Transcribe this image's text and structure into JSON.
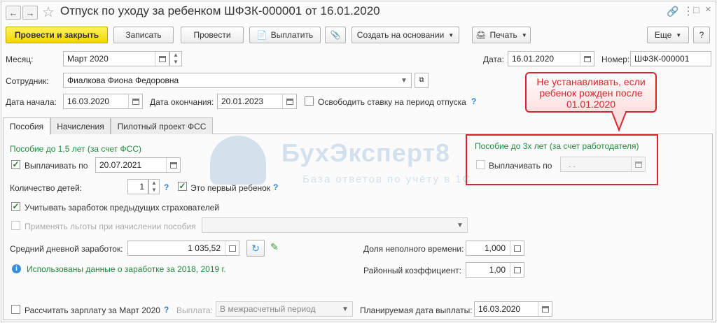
{
  "header": {
    "title": "Отпуск по уходу за ребенком ШФЗК-000001 от 16.01.2020",
    "back_icon": "arrow-left-icon",
    "forward_icon": "arrow-right-icon",
    "star_icon": "star-icon"
  },
  "toolbar": {
    "post_close": "Провести и закрыть",
    "save": "Записать",
    "post": "Провести",
    "pay": "Выплатить",
    "create_based": "Создать на основании",
    "print": "Печать",
    "more": "Еще",
    "help": "?"
  },
  "fields": {
    "month_label": "Месяц:",
    "month_value": "Март 2020",
    "date_label": "Дата:",
    "date_value": "16.01.2020",
    "number_label": "Номер:",
    "number_value": "ШФЗК-000001",
    "employee_label": "Сотрудник:",
    "employee_value": "Фиалкова Фиона Федоровна",
    "start_label": "Дата начала:",
    "start_value": "16.03.2020",
    "end_label": "Дата окончания:",
    "end_value": "20.01.2023",
    "free_rate_label": "Освободить ставку на период отпуска",
    "q": "?"
  },
  "tabs": [
    "Пособия",
    "Начисления",
    "Пилотный проект ФСС"
  ],
  "benefits": {
    "section_15_title": "Пособие до 1,5 лет (за счет ФСС)",
    "pay_until_label": "Выплачивать по",
    "pay_until_value": "20.07.2021",
    "children_label": "Количество детей:",
    "children_value": "1",
    "first_child_label": "Это первый ребенок",
    "consider_prev_label": "Учитывать заработок предыдущих страхователей",
    "apply_benefits_label": "Применять льготы при начислении пособия",
    "avg_earnings_label": "Средний дневной заработок:",
    "avg_earnings_value": "1 035,52",
    "info_text": "Использованы данные о заработке за  2018,  2019 г.",
    "section_3_title": "Пособие до 3х лет (за счет работодателя)",
    "pay_until3_label": "Выплачивать по",
    "pay_until3_value": " .  .",
    "part_time_label": "Доля неполного времени:",
    "part_time_value": "1,000",
    "regional_label": "Районный коэффициент:",
    "regional_value": "1,00",
    "calc_salary_label": "Рассчитать зарплату за Март 2020",
    "payment_label": "Выплата:",
    "payment_value": "В межрасчетный период",
    "planned_date_label": "Планируемая дата выплаты:",
    "planned_date_value": "16.03.2020"
  },
  "callout": {
    "text": "Не устанавливать, если ребенок рожден после 01.01.2020"
  },
  "watermark": {
    "brand": "БухЭксперт8",
    "tagline": "База ответов по учёту в 1С"
  },
  "colors": {
    "primary_button": "#f2d600",
    "section_green": "#1e8a3c",
    "annotation_red": "#d8262c",
    "help_blue": "#2f7fd0"
  }
}
